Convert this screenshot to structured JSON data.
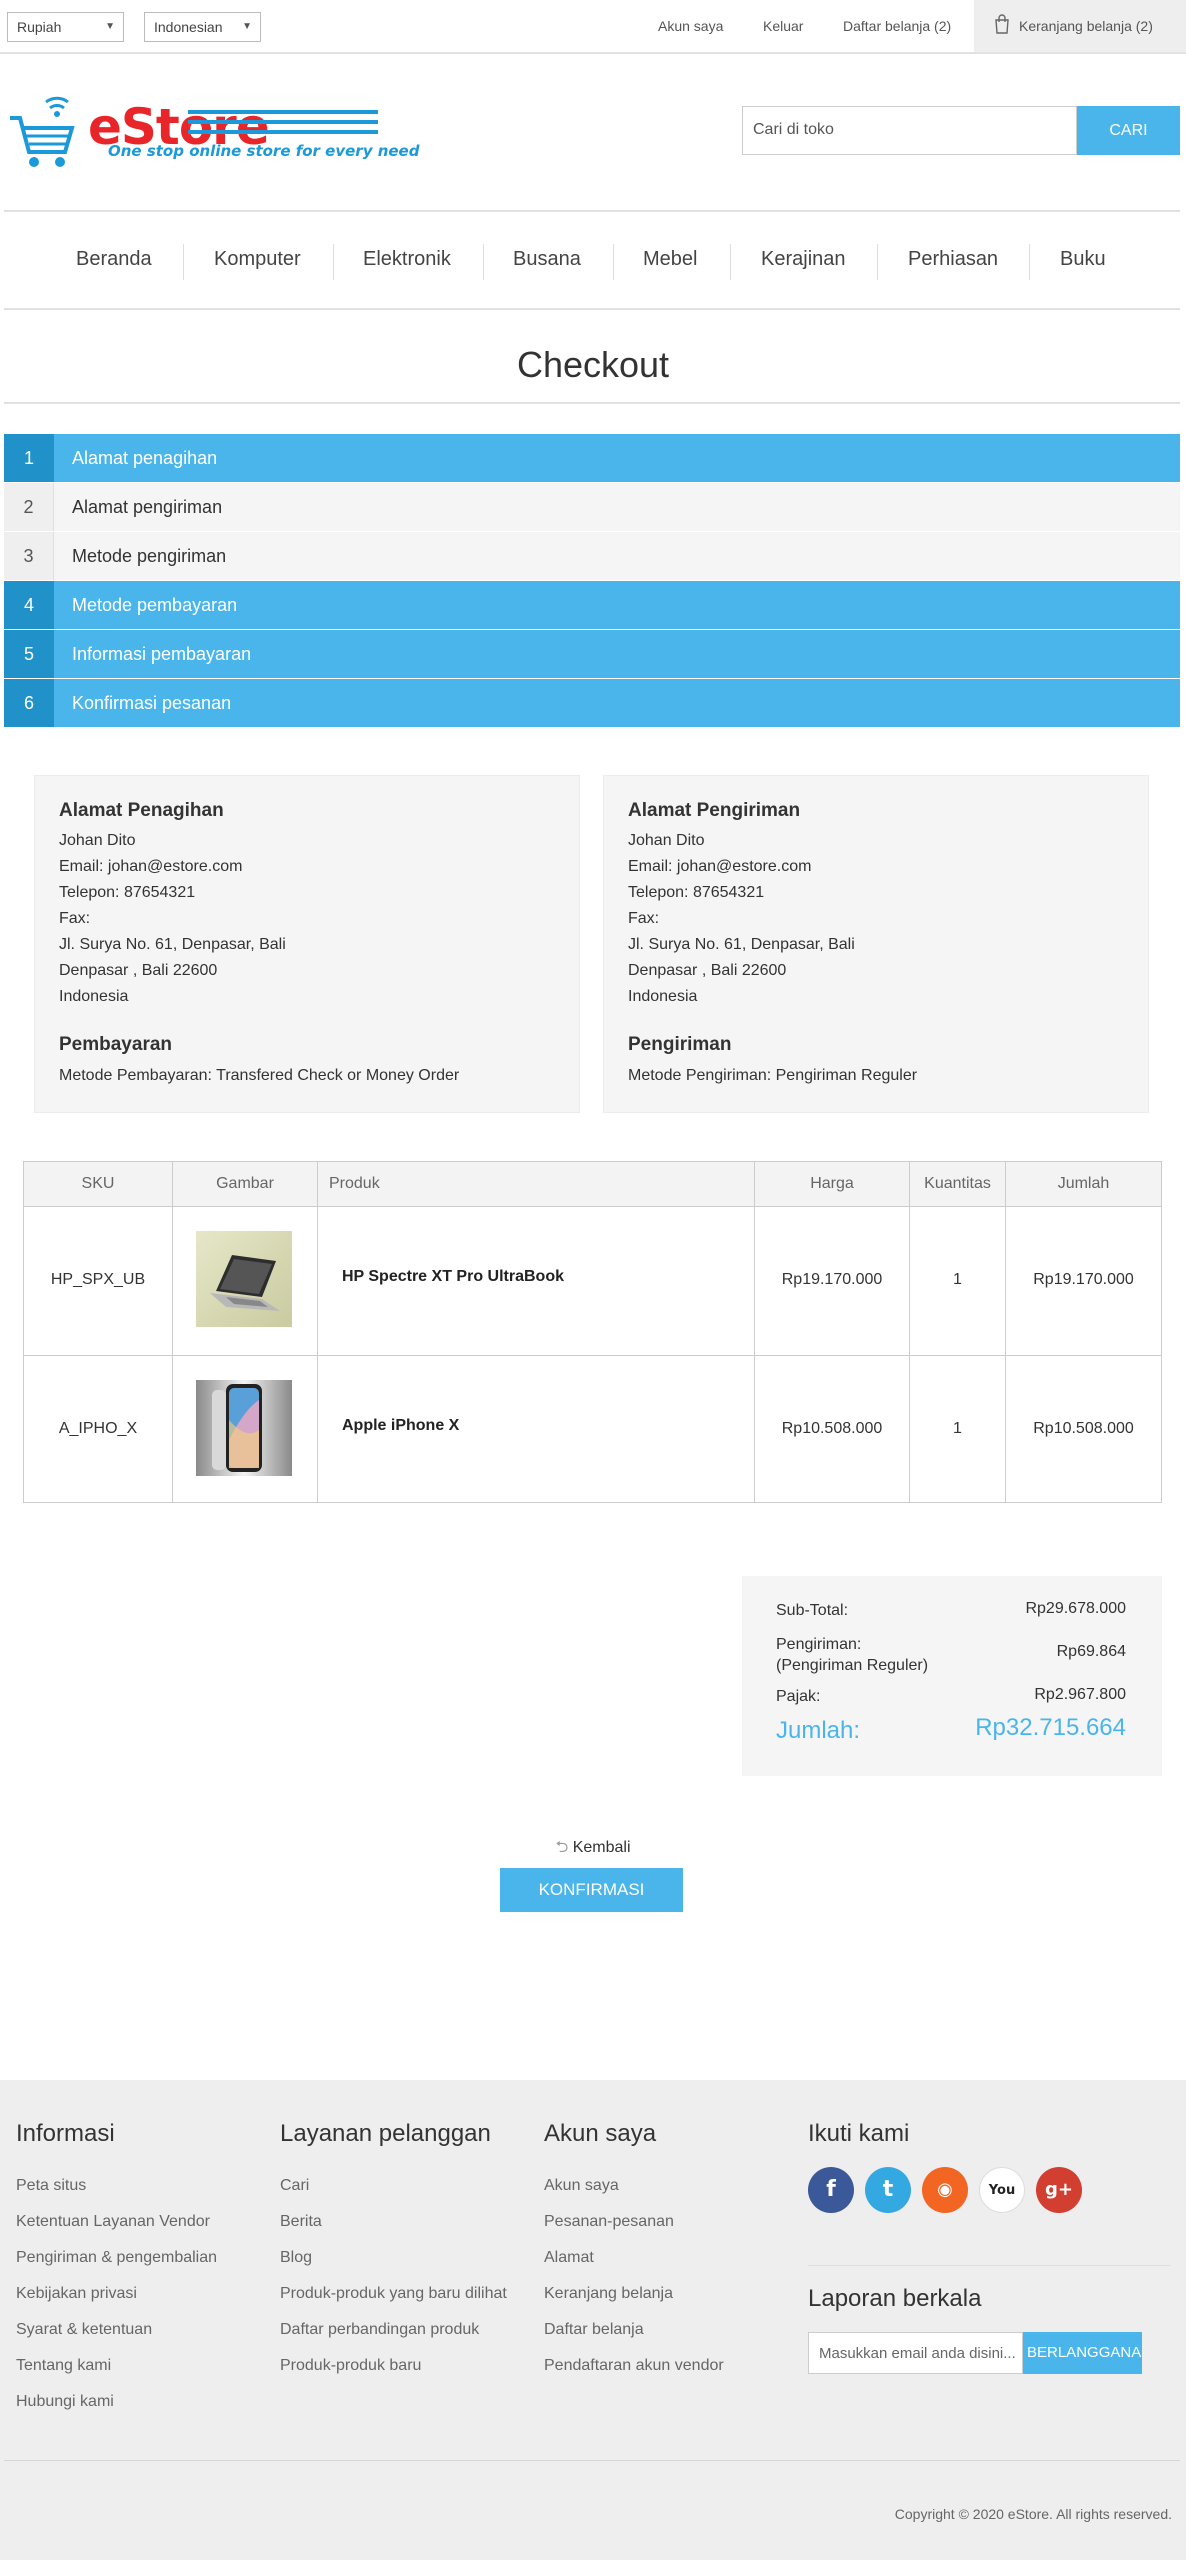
{
  "topbar": {
    "currency": "Rupiah",
    "language": "Indonesian",
    "my_account": "Akun saya",
    "logout": "Keluar",
    "wishlist": "Daftar belanja (2)",
    "cart": "Keranjang belanja (2)"
  },
  "header": {
    "logo_e": "e",
    "logo_store": "Store",
    "tagline": "One stop online store for every need",
    "search_placeholder": "Cari di toko",
    "search_button": "CARI"
  },
  "nav": [
    "Beranda",
    "Komputer",
    "Elektronik",
    "Busana",
    "Mebel",
    "Kerajinan",
    "Perhiasan",
    "Buku"
  ],
  "page_title": "Checkout",
  "steps": [
    {
      "num": "1",
      "label": "Alamat penagihan"
    },
    {
      "num": "2",
      "label": "Alamat pengiriman"
    },
    {
      "num": "3",
      "label": "Metode pengiriman"
    },
    {
      "num": "4",
      "label": "Metode pembayaran"
    },
    {
      "num": "5",
      "label": "Informasi pembayaran"
    },
    {
      "num": "6",
      "label": "Konfirmasi pesanan"
    }
  ],
  "billing": {
    "title": "Alamat Penagihan",
    "name": "Johan Dito",
    "email": "Email: johan@estore.com",
    "phone": "Telepon: 87654321",
    "fax": "Fax:",
    "address1": "Jl. Surya No. 61, Denpasar, Bali",
    "address2": "Denpasar , Bali 22600",
    "country": "Indonesia",
    "method_title": "Pembayaran",
    "method": "Metode Pembayaran: Transfered Check or Money Order"
  },
  "shipping": {
    "title": "Alamat Pengiriman",
    "name": "Johan Dito",
    "email": "Email: johan@estore.com",
    "phone": "Telepon: 87654321",
    "fax": "Fax:",
    "address1": "Jl. Surya No. 61, Denpasar, Bali",
    "address2": "Denpasar , Bali 22600",
    "country": "Indonesia",
    "method_title": "Pengiriman",
    "method": "Metode Pengiriman: Pengiriman Reguler"
  },
  "table": {
    "headers": {
      "sku": "SKU",
      "image": "Gambar",
      "product": "Produk",
      "price": "Harga",
      "qty": "Kuantitas",
      "total": "Jumlah"
    },
    "rows": [
      {
        "sku": "HP_SPX_UB",
        "product": "HP Spectre XT Pro UltraBook",
        "price": "Rp19.170.000",
        "qty": "1",
        "total": "Rp19.170.000"
      },
      {
        "sku": "A_IPHO_X",
        "product": "Apple iPhone X",
        "price": "Rp10.508.000",
        "qty": "1",
        "total": "Rp10.508.000"
      }
    ]
  },
  "totals": {
    "subtotal_label": "Sub-Total:",
    "subtotal": "Rp29.678.000",
    "shipping_label1": "Pengiriman:",
    "shipping_label2": "(Pengiriman Reguler)",
    "shipping": "Rp69.864",
    "tax_label": "Pajak:",
    "tax": "Rp2.967.800",
    "total_label": "Jumlah:",
    "total": "Rp32.715.664"
  },
  "actions": {
    "back": "Kembali",
    "confirm": "KONFIRMASI"
  },
  "footer": {
    "info_title": "Informasi",
    "info_links": [
      "Peta situs",
      "Ketentuan Layanan Vendor",
      "Pengiriman & pengembalian",
      "Kebijakan privasi",
      "Syarat & ketentuan",
      "Tentang kami",
      "Hubungi kami"
    ],
    "service_title": "Layanan pelanggan",
    "service_links": [
      "Cari",
      "Berita",
      "Blog",
      "Produk-produk yang baru dilihat",
      "Daftar perbandingan produk",
      "Produk-produk baru"
    ],
    "account_title": "Akun saya",
    "account_links": [
      "Akun saya",
      "Pesanan-pesanan",
      "Alamat",
      "Keranjang belanja",
      "Daftar belanja",
      "Pendaftaran akun vendor"
    ],
    "follow_title": "Ikuti kami",
    "social": [
      {
        "icon": "facebook-icon",
        "glyph": "f",
        "color": "#3b5998"
      },
      {
        "icon": "twitter-icon",
        "glyph": "t",
        "color": "#34a8e0"
      },
      {
        "icon": "rss-icon",
        "glyph": "◉",
        "color": "#f26522"
      },
      {
        "icon": "youtube-icon",
        "glyph": "You",
        "color": "#ffffff"
      },
      {
        "icon": "google-plus-icon",
        "glyph": "g+",
        "color": "#d23f31"
      }
    ],
    "newsletter_title": "Laporan berkala",
    "newsletter_placeholder": "Masukkan email anda disini...",
    "newsletter_button": "BERLANGGANAN",
    "copyright": "Copyright © 2020 eStore. All rights reserved."
  },
  "colors": {
    "accent": "#4ab5eb",
    "accent_dark": "#2192c9",
    "logo_red": "#e8262a",
    "logo_blue": "#1b99d8"
  }
}
